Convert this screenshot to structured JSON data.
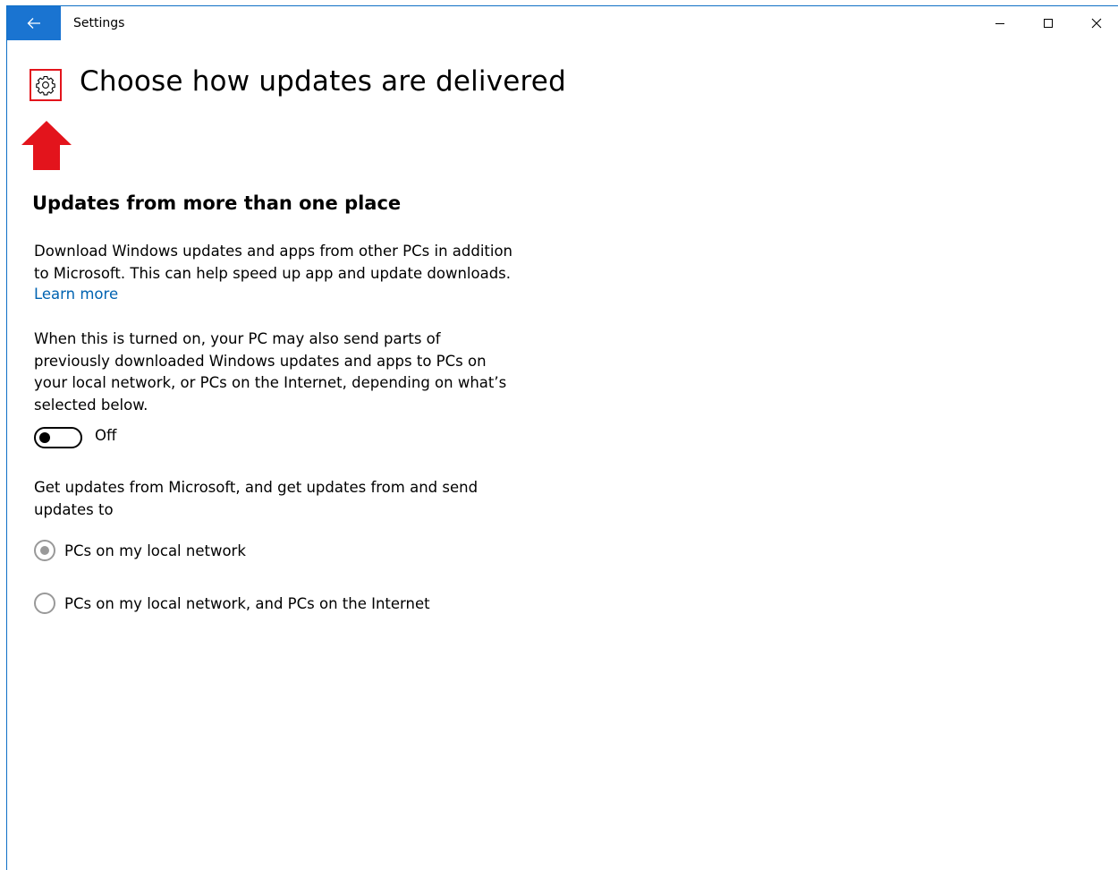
{
  "window": {
    "title": "Settings"
  },
  "header": {
    "page_title": "Choose how updates are delivered"
  },
  "section": {
    "title": "Updates from more than one place",
    "description": "Download Windows updates and apps from other PCs in addition to Microsoft. This can help speed up app and update downloads.",
    "learn_more_label": "Learn more",
    "sharing_note": "When this is turned on, your PC may also send parts of previously downloaded Windows updates and apps to PCs on your local network, or PCs on the Internet, depending on what’s selected below.",
    "toggle": {
      "state_label": "Off",
      "on": false
    },
    "options_intro": "Get updates from Microsoft, and get updates from and send updates to",
    "options": [
      {
        "label": "PCs on my local network",
        "selected": true,
        "enabled": false
      },
      {
        "label": "PCs on my local network, and PCs on the Internet",
        "selected": false,
        "enabled": false
      }
    ]
  },
  "icons": {
    "back": "back-arrow-icon",
    "minimize": "minimize-icon",
    "maximize": "maximize-icon",
    "close": "close-icon",
    "settings": "gear-icon",
    "annotation": "red-up-arrow-icon"
  },
  "colors": {
    "accent": "#1a74d1",
    "link": "#0063b1",
    "highlight": "#e3141c",
    "disabled": "#999999"
  }
}
